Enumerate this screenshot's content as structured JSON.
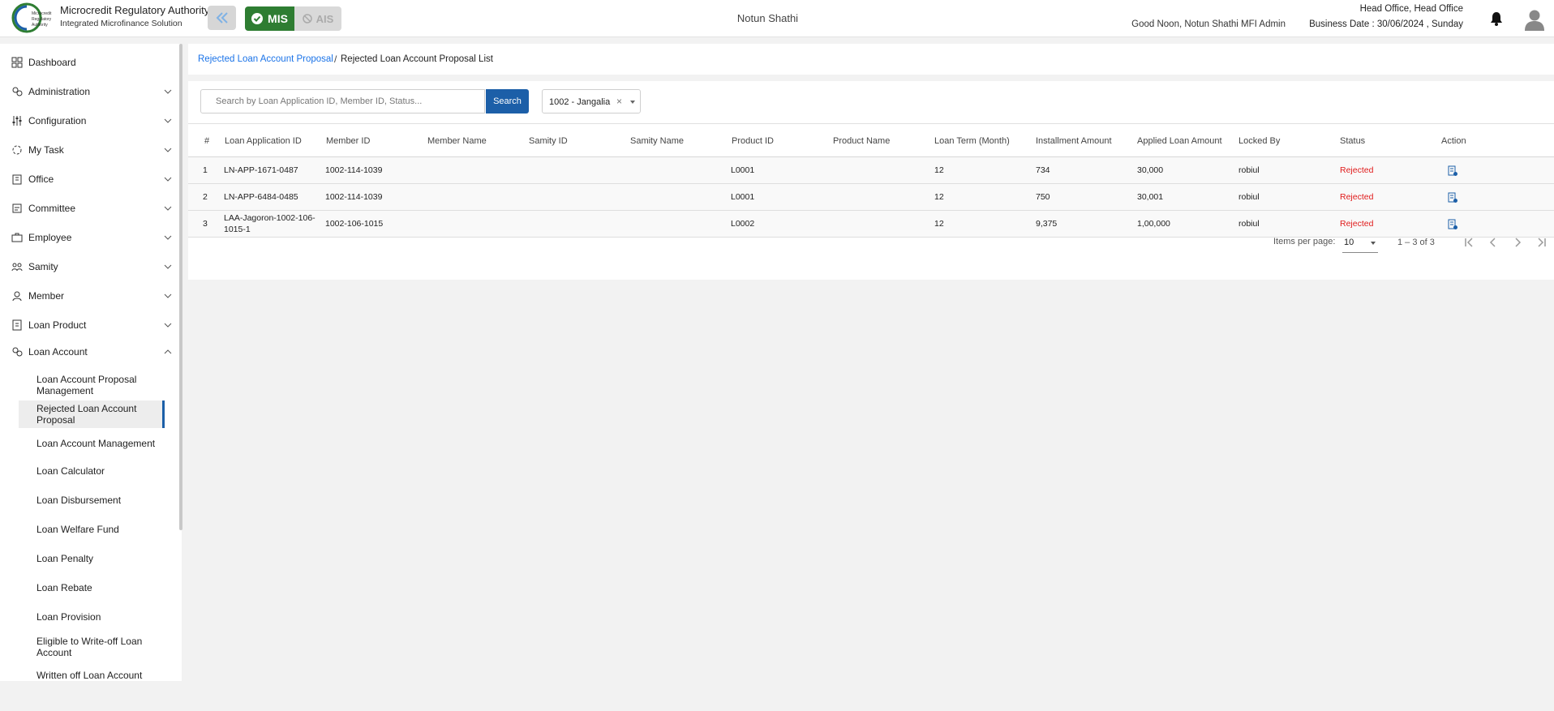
{
  "header": {
    "logo_text": "Microcredit Regulatory Authority",
    "brand_title": "Microcredit Regulatory Authority",
    "brand_subtitle": "Integrated Microfinance Solution",
    "mis_label": "MIS",
    "ais_label": "AIS",
    "org_name": "Notun Shathi",
    "greeting": "Good Noon, Notun Shathi MFI Admin",
    "office": "Head Office, Head Office",
    "business_date": "Business Date : 30/06/2024 , Sunday"
  },
  "sidebar": {
    "items": [
      {
        "label": "Dashboard",
        "icon": "dashboard-icon",
        "expandable": false
      },
      {
        "label": "Administration",
        "icon": "administration-icon",
        "expandable": true
      },
      {
        "label": "Configuration",
        "icon": "configuration-icon",
        "expandable": true
      },
      {
        "label": "My Task",
        "icon": "task-icon",
        "expandable": true
      },
      {
        "label": "Office",
        "icon": "office-icon",
        "expandable": true
      },
      {
        "label": "Committee",
        "icon": "committee-icon",
        "expandable": true
      },
      {
        "label": "Employee",
        "icon": "employee-icon",
        "expandable": true
      },
      {
        "label": "Samity",
        "icon": "samity-icon",
        "expandable": true
      },
      {
        "label": "Member",
        "icon": "member-icon",
        "expandable": true
      },
      {
        "label": "Loan Product",
        "icon": "loan-product-icon",
        "expandable": true
      },
      {
        "label": "Loan Account",
        "icon": "loan-account-icon",
        "expandable": true,
        "expanded": true
      }
    ],
    "loan_account_sub": [
      {
        "label": "Loan Account Proposal Management"
      },
      {
        "label": "Rejected Loan Account Proposal",
        "active": true
      },
      {
        "label": "Loan Account Management"
      },
      {
        "label": "Loan Calculator"
      },
      {
        "label": "Loan Disbursement"
      },
      {
        "label": "Loan Welfare Fund"
      },
      {
        "label": "Loan Penalty"
      },
      {
        "label": "Loan Rebate"
      },
      {
        "label": "Loan Provision"
      },
      {
        "label": "Eligible to Write-off Loan Account"
      },
      {
        "label": "Written off Loan Account"
      }
    ]
  },
  "breadcrumb": {
    "link": "Rejected Loan Account Proposal",
    "separator": "/",
    "current": "Rejected Loan Account Proposal List"
  },
  "search": {
    "placeholder": "Search by Loan Application ID, Member ID, Status...",
    "value": "",
    "button_label": "Search"
  },
  "branch_filter": {
    "value": "1002 - Jangalia",
    "clear": "×"
  },
  "table": {
    "columns": [
      "#",
      "Loan Application ID",
      "Member ID",
      "Member Name",
      "Samity ID",
      "Samity Name",
      "Product ID",
      "Product Name",
      "Loan Term (Month)",
      "Installment Amount",
      "Applied Loan Amount",
      "Locked By",
      "Status",
      "Action"
    ],
    "rows": [
      {
        "no": "1",
        "loan_app_id": "LN-APP-1671-0487",
        "member_id": "1002-114-1039",
        "member_name": "",
        "samity_id": "",
        "samity_name": "",
        "product_id": "L0001",
        "product_name": "",
        "loan_term": "12",
        "installment": "734",
        "applied": "30,000",
        "locked_by": "robiul",
        "status": "Rejected"
      },
      {
        "no": "2",
        "loan_app_id": "LN-APP-6484-0485",
        "member_id": "1002-114-1039",
        "member_name": "",
        "samity_id": "",
        "samity_name": "",
        "product_id": "L0001",
        "product_name": "",
        "loan_term": "12",
        "installment": "750",
        "applied": "30,001",
        "locked_by": "robiul",
        "status": "Rejected"
      },
      {
        "no": "3",
        "loan_app_id": "LAA-Jagoron-1002-106-1015-1",
        "member_id": "1002-106-1015",
        "member_name": "",
        "samity_id": "",
        "samity_name": "",
        "product_id": "L0002",
        "product_name": "",
        "loan_term": "12",
        "installment": "9,375",
        "applied": "1,00,000",
        "locked_by": "robiul",
        "status": "Rejected"
      }
    ]
  },
  "pagination": {
    "items_per_page_label": "Items per page:",
    "items_per_page": "10",
    "range": "1 – 3 of 3"
  },
  "colors": {
    "primary": "#1c5fa8",
    "link": "#1a73e8",
    "mis_green": "#2e7d32",
    "status_rejected": "#e01b1b"
  }
}
